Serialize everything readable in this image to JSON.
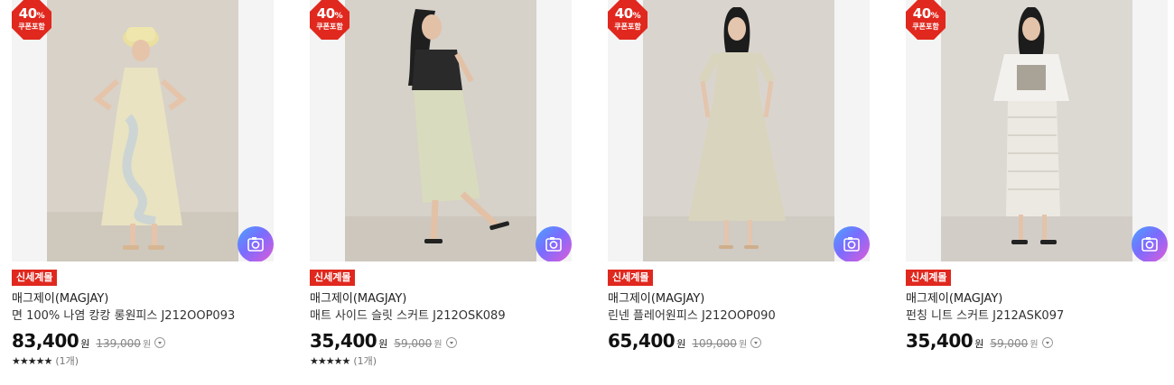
{
  "coupon_badge": {
    "percent": "40",
    "percent_sign": "%",
    "label": "쿠폰포함"
  },
  "colors": {
    "badge_red": "#e0281e",
    "tag_red": "#e0281e",
    "camera_gradient_start": "#4aa3ff",
    "camera_gradient_end": "#e05bd7"
  },
  "products": [
    {
      "tag": "신세계몰",
      "brand": "매그제이(MAGJAY)",
      "name": "면 100% 나염 캉캉 롱원피스 J212OOP093",
      "sale_price": "83,400",
      "sale_unit": "원",
      "original_price": "139,000",
      "original_unit": "원",
      "stars": "★★★★★",
      "review_count": "(1개)",
      "image_desc_icon": "dress-model-photo"
    },
    {
      "tag": "신세계몰",
      "brand": "매그제이(MAGJAY)",
      "name": "매트 사이드 슬릿 스커트 J212OSK089",
      "sale_price": "35,400",
      "sale_unit": "원",
      "original_price": "59,000",
      "original_unit": "원",
      "stars": "★★★★★",
      "review_count": "(1개)",
      "image_desc_icon": "skirt-model-photo"
    },
    {
      "tag": "신세계몰",
      "brand": "매그제이(MAGJAY)",
      "name": "린넨 플레어원피스 J212OOP090",
      "sale_price": "65,400",
      "sale_unit": "원",
      "original_price": "109,000",
      "original_unit": "원",
      "image_desc_icon": "dress-model-photo"
    },
    {
      "tag": "신세계몰",
      "brand": "매그제이(MAGJAY)",
      "name": "펀칭 니트 스커트 J212ASK097",
      "sale_price": "35,400",
      "sale_unit": "원",
      "original_price": "59,000",
      "original_unit": "원",
      "image_desc_icon": "skirt-model-photo"
    }
  ]
}
